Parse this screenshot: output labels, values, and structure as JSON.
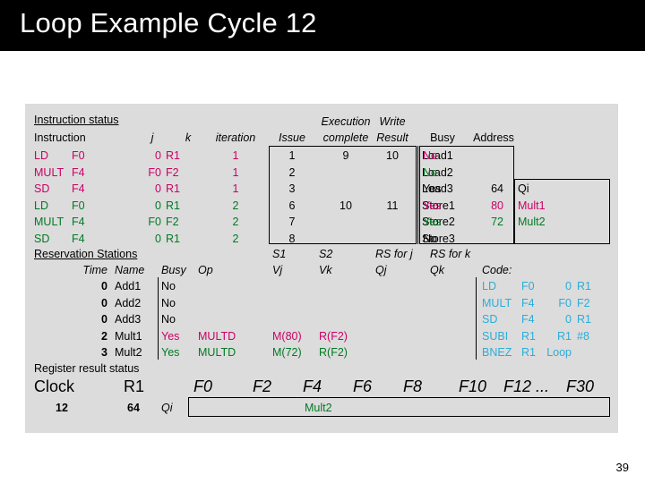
{
  "slide": {
    "title": "Loop Example Cycle 12",
    "page_number": "39"
  },
  "instruction_status": {
    "section_label": "Instruction status",
    "headers": {
      "instruction": "Instruction",
      "j": "j",
      "k": "k",
      "iteration": "iteration",
      "issue": "Issue",
      "execution": "Execution",
      "complete": "complete",
      "write": "Write",
      "result": "Result"
    },
    "rows": [
      {
        "op": "LD",
        "dest": "F0",
        "j": "0",
        "k": "R1",
        "iteration": "1",
        "issue": "1",
        "exec_complete": "9",
        "write_result": "10",
        "color": "mag"
      },
      {
        "op": "MULT",
        "dest": "F4",
        "j": "F0",
        "k": "F2",
        "iteration": "1",
        "issue": "2",
        "exec_complete": "",
        "write_result": "",
        "color": "mag"
      },
      {
        "op": "SD",
        "dest": "F4",
        "j": "0",
        "k": "R1",
        "iteration": "1",
        "issue": "3",
        "exec_complete": "",
        "write_result": "",
        "color": "mag"
      },
      {
        "op": "LD",
        "dest": "F0",
        "j": "0",
        "k": "R1",
        "iteration": "2",
        "issue": "6",
        "exec_complete": "10",
        "write_result": "11",
        "color": "grn"
      },
      {
        "op": "MULT",
        "dest": "F4",
        "j": "F0",
        "k": "F2",
        "iteration": "2",
        "issue": "7",
        "exec_complete": "",
        "write_result": "",
        "color": "grn"
      },
      {
        "op": "SD",
        "dest": "F4",
        "j": "0",
        "k": "R1",
        "iteration": "2",
        "issue": "8",
        "exec_complete": "",
        "write_result": "",
        "color": "grn"
      }
    ]
  },
  "load_store_buffers": {
    "headers": {
      "busy": "Busy",
      "address": "Address",
      "qi": "Qi"
    },
    "rows": [
      {
        "name": "Load1",
        "busy": "No",
        "address": "",
        "qi": "",
        "color": "mag"
      },
      {
        "name": "Load2",
        "busy": "No",
        "address": "",
        "qi": "",
        "color": "grn"
      },
      {
        "name": "Load3",
        "busy": "Yes",
        "address": "64",
        "qi": "",
        "color": "blk"
      },
      {
        "name": "Store1",
        "busy": "Yes",
        "address": "80",
        "qi": "Mult1",
        "color": "mag"
      },
      {
        "name": "Store2",
        "busy": "Yes",
        "address": "72",
        "qi": "Mult2",
        "color": "grn"
      },
      {
        "name": "Store3",
        "busy": "No",
        "address": "",
        "qi": "",
        "color": "blk"
      }
    ]
  },
  "reservation_stations": {
    "section_label": "Reservation Stations",
    "headers": {
      "time": "Time",
      "name": "Name",
      "busy": "Busy",
      "op": "Op",
      "s1": "S1",
      "vj": "Vj",
      "s2": "S2",
      "vk": "Vk",
      "rs_for_j": "RS for j",
      "qj": "Qj",
      "rs_for_k": "RS for k",
      "qk": "Qk"
    },
    "rows": [
      {
        "time": "0",
        "name": "Add1",
        "busy": "No",
        "op": "",
        "vj": "",
        "vk": "",
        "qj": "",
        "qk": "",
        "color": "blk"
      },
      {
        "time": "0",
        "name": "Add2",
        "busy": "No",
        "op": "",
        "vj": "",
        "vk": "",
        "qj": "",
        "qk": "",
        "color": "blk"
      },
      {
        "time": "0",
        "name": "Add3",
        "busy": "No",
        "op": "",
        "vj": "",
        "vk": "",
        "qj": "",
        "qk": "",
        "color": "blk"
      },
      {
        "time": "2",
        "name": "Mult1",
        "busy": "Yes",
        "op": "MULTD",
        "vj": "M(80)",
        "vk": "R(F2)",
        "qj": "",
        "qk": "",
        "color": "mag"
      },
      {
        "time": "3",
        "name": "Mult2",
        "busy": "Yes",
        "op": "MULTD",
        "vj": "M(72)",
        "vk": "R(F2)",
        "qj": "",
        "qk": "",
        "color": "grn"
      }
    ]
  },
  "code": {
    "label": "Code:",
    "lines": [
      {
        "op": "LD",
        "a": "F0",
        "b": "0",
        "c": "R1"
      },
      {
        "op": "MULT",
        "a": "F4",
        "b": "F0",
        "c": "F2"
      },
      {
        "op": "SD",
        "a": "F4",
        "b": "0",
        "c": "R1"
      },
      {
        "op": "SUBI",
        "a": "R1",
        "b": "R1",
        "c": "#8"
      },
      {
        "op": "BNEZ",
        "a": "R1",
        "b": "Loop",
        "c": ""
      }
    ]
  },
  "register_result_status": {
    "section_label": "Register result status",
    "clock_label": "Clock",
    "clock_value": "12",
    "r1_label": "R1",
    "r1_value": "64",
    "qi_label": "Qi",
    "registers": [
      "F0",
      "F2",
      "F4",
      "F6",
      "F8",
      "F10",
      "F12 ...",
      "F30"
    ],
    "values": [
      "",
      "",
      "Mult2",
      "",
      "",
      "",
      "",
      ""
    ]
  },
  "colors": {
    "magenta": "#cc0066",
    "green": "#007a22",
    "cyan": "#2badd8",
    "panel_bg": "#dcdcdc",
    "title_bg": "#000000"
  }
}
